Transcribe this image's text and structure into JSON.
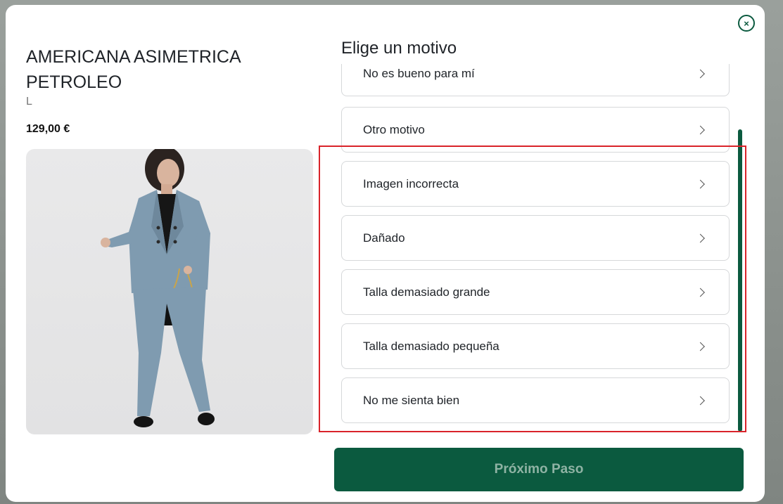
{
  "product": {
    "title": "AMERICANA ASIMETRICA PETROLEO",
    "size": "L",
    "price": "129,00 €"
  },
  "reasons_section": {
    "title": "Elige un motivo",
    "items": [
      {
        "label": "No es bueno para mí"
      },
      {
        "label": "Otro motivo"
      },
      {
        "label": "Imagen incorrecta"
      },
      {
        "label": "Dañado"
      },
      {
        "label": "Talla demasiado grande"
      },
      {
        "label": "Talla demasiado pequeña"
      },
      {
        "label": "No me sienta bien"
      }
    ]
  },
  "actions": {
    "next_label": "Próximo Paso",
    "close_symbol": "×"
  },
  "colors": {
    "brand_green": "#0b5a3f",
    "highlight_red": "#d9232a",
    "suit_blue": "#7f9bb0"
  },
  "icons": [
    "close-icon",
    "chevron-right-icon"
  ]
}
